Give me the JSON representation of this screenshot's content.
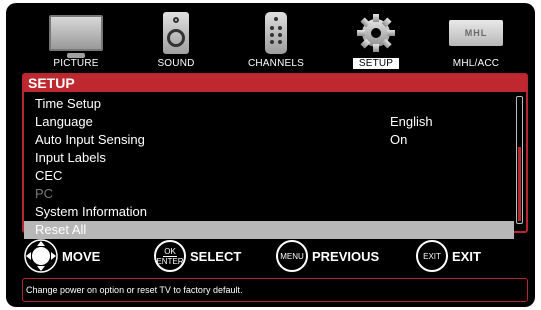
{
  "tabs": [
    {
      "label": "PICTURE",
      "icon": "tv-icon"
    },
    {
      "label": "SOUND",
      "icon": "speaker-icon"
    },
    {
      "label": "CHANNELS",
      "icon": "remote-icon"
    },
    {
      "label": "SETUP",
      "icon": "gear-icon"
    },
    {
      "label": "MHL/ACC",
      "icon": "mhl-icon"
    }
  ],
  "mhl_logo_text": "MHL",
  "setup": {
    "title": "SETUP",
    "items": [
      {
        "label": "Time Setup",
        "value": ""
      },
      {
        "label": "Language",
        "value": "English"
      },
      {
        "label": "Auto Input Sensing",
        "value": "On"
      },
      {
        "label": "Input Labels",
        "value": ""
      },
      {
        "label": "CEC",
        "value": ""
      },
      {
        "label": "PC",
        "value": ""
      },
      {
        "label": "System Information",
        "value": ""
      },
      {
        "label": "Reset All",
        "value": ""
      }
    ]
  },
  "hints": {
    "move": "MOVE",
    "ok_top": "OK",
    "ok_bottom": "ENTER",
    "select": "SELECT",
    "menu_key": "MENU",
    "previous": "PREVIOUS",
    "exit_key": "EXIT",
    "exit": "EXIT"
  },
  "help_text": "Change power on option or reset TV to factory default.",
  "colors": {
    "accent_red": "#c0282f",
    "selected_row": "#b7b7b7",
    "disabled_text": "#7a7a7a",
    "background": "#000000"
  }
}
